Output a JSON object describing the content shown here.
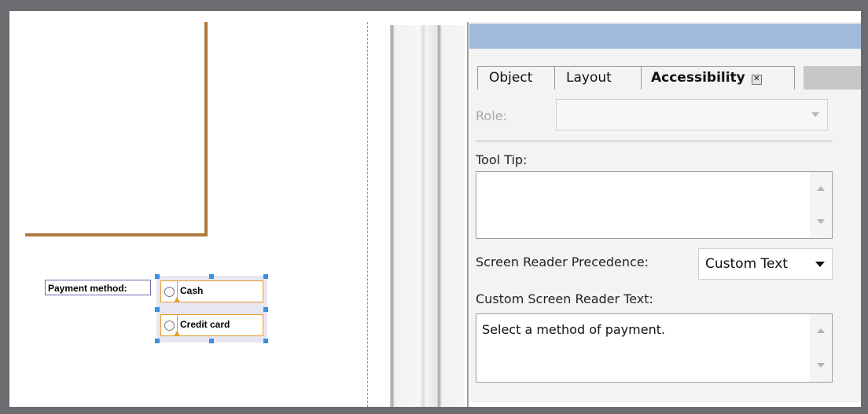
{
  "canvas": {
    "field_label": "Payment method:",
    "options": [
      "Cash",
      "Credit card"
    ]
  },
  "panel": {
    "tabs": [
      {
        "label": "Object"
      },
      {
        "label": "Layout"
      },
      {
        "label": "Accessibility"
      }
    ],
    "role": {
      "label": "Role:",
      "value": ""
    },
    "tool_tip": {
      "label": "Tool Tip:",
      "value": ""
    },
    "screen_reader_precedence": {
      "label": "Screen Reader Precedence:",
      "value": "Custom Text"
    },
    "custom_screen_reader_text": {
      "label": "Custom Screen Reader Text:",
      "value": "Select a method of payment."
    }
  },
  "colors": {
    "page_border": "#b07a3d",
    "selection_handle": "#3c8fe6",
    "field_outline": "#e69a2a",
    "panel_titlebar": "#9fbbd9"
  },
  "icons": [
    "radio-button-icon",
    "tab-close-icon",
    "dropdown-arrow-icon",
    "scroll-up-icon",
    "scroll-down-icon"
  ]
}
